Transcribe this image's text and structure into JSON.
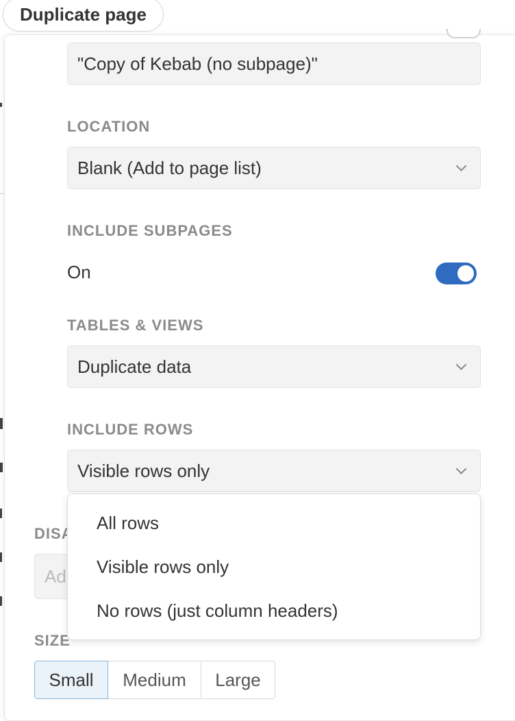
{
  "header": {
    "duplicate_page_label": "Duplicate page"
  },
  "form": {
    "title_value": "\"Copy of Kebab (no subpage)\"",
    "location": {
      "label": "LOCATION",
      "value": "Blank (Add to page list)"
    },
    "include_subpages": {
      "label": "INCLUDE SUBPAGES",
      "state_text": "On",
      "enabled": true
    },
    "tables_views": {
      "label": "TABLES & VIEWS",
      "value": "Duplicate data"
    },
    "include_rows": {
      "label": "INCLUDE ROWS",
      "value": "Visible rows only",
      "options": [
        "All rows",
        "Visible rows only",
        "No rows (just column headers)"
      ]
    },
    "display": {
      "label_partial": "DISA",
      "placeholder_partial": "Ad"
    },
    "size": {
      "label": "SIZE",
      "options": [
        "Small",
        "Medium",
        "Large"
      ],
      "selected": "Small"
    }
  },
  "colors": {
    "toggle_on": "#2f6bbf",
    "selected_segment_bg": "#eaf2fa",
    "selected_segment_border": "#8cb4dc"
  },
  "icons": {
    "dropdown": "chevron-down-icon",
    "toggle": "toggle-switch-icon"
  }
}
